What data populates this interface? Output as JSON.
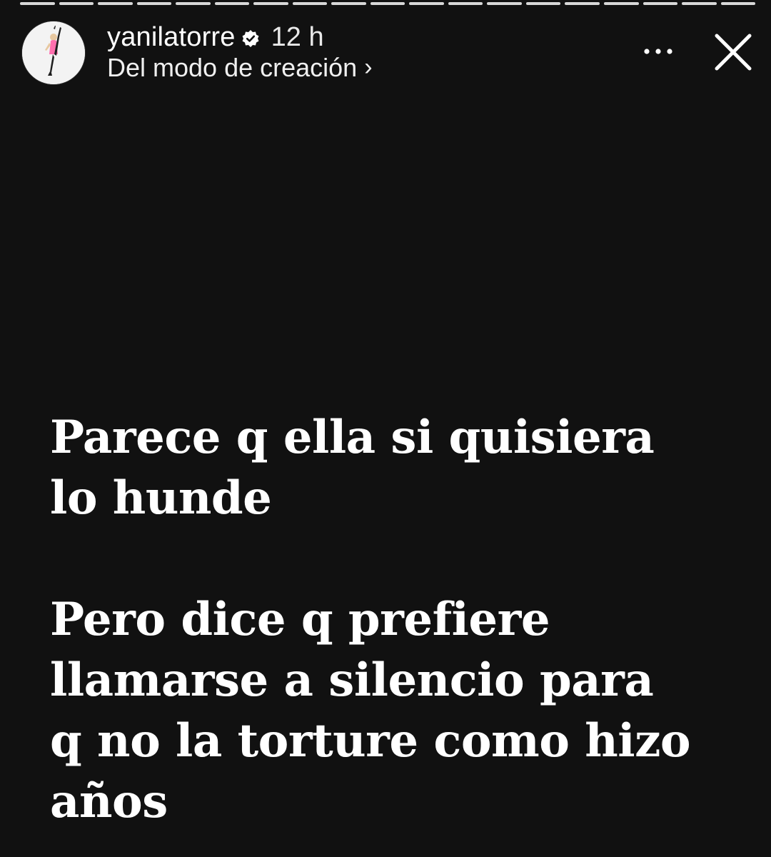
{
  "progress": {
    "segments": 19,
    "current_index": 18
  },
  "header": {
    "username": "yanilatorre",
    "verified_icon": "verified-badge-icon",
    "timestamp": "12 h",
    "subtitle": "Del modo de creación",
    "subtitle_chevron": "›",
    "more_icon": "more-horizontal-icon",
    "close_icon": "close-icon"
  },
  "story": {
    "paragraphs": [
      "Parece q ella si quisiera\nlo hunde",
      "Pero dice q prefiere\nllamarse a silencio para\nq no la torture como hizo\naños"
    ]
  },
  "colors": {
    "background": "#111111",
    "text": "#ffffff",
    "progress_active": "#d8d8d8"
  }
}
